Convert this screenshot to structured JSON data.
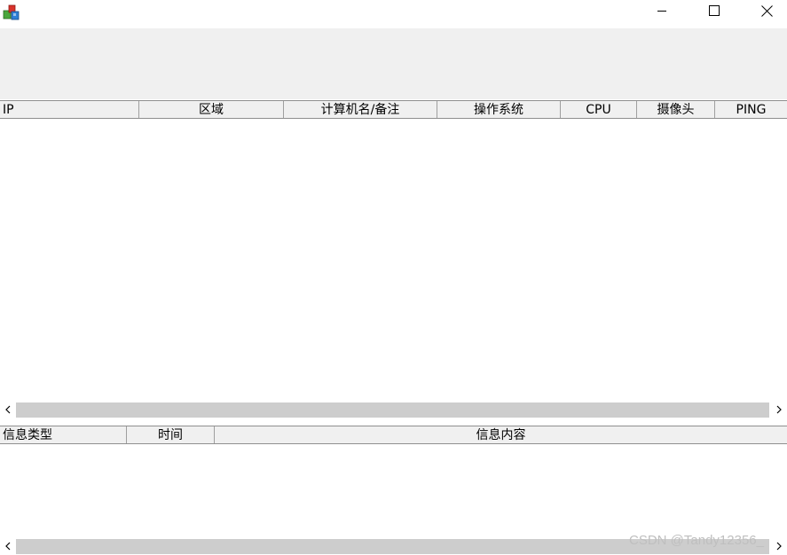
{
  "window": {
    "icon": "app-cubes-icon",
    "minimize_icon": "minimize-icon",
    "maximize_icon": "maximize-icon",
    "close_icon": "close-icon"
  },
  "hosts_table": {
    "columns": [
      "IP",
      "区域",
      "计算机名/备注",
      "操作系统",
      "CPU",
      "摄像头",
      "PING"
    ],
    "rows": []
  },
  "log_table": {
    "columns": [
      "信息类型",
      "时间",
      "信息内容"
    ],
    "rows": []
  },
  "watermark": "CSDN @Tandy12356_",
  "colors": {
    "toolbar_bg": "#f0f0f0",
    "scroll_thumb": "#cdcdcd",
    "window_bg": "#ffffff"
  }
}
